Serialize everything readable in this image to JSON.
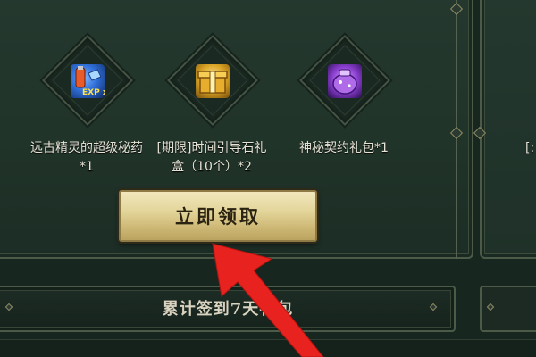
{
  "rewards": {
    "items": [
      {
        "name": "远古精灵的超级秘药*1",
        "icon": "potion-vial-icon",
        "color": "#2f6fd8",
        "badge": "EXP x3"
      },
      {
        "name": "[期限]时间引导石礼盒（10个）*2",
        "icon": "golden-treasure-box-icon",
        "color": "#d9a323"
      },
      {
        "name": "神秘契约礼包*1",
        "icon": "purple-gift-pouch-icon",
        "color": "#8b3fd0"
      }
    ],
    "partial_item_text": "[:"
  },
  "claim_button": {
    "label": "立即领取"
  },
  "bottom": {
    "title": "累计签到7天礼包"
  },
  "overlay": {
    "arrow_color": "#e8221e"
  }
}
